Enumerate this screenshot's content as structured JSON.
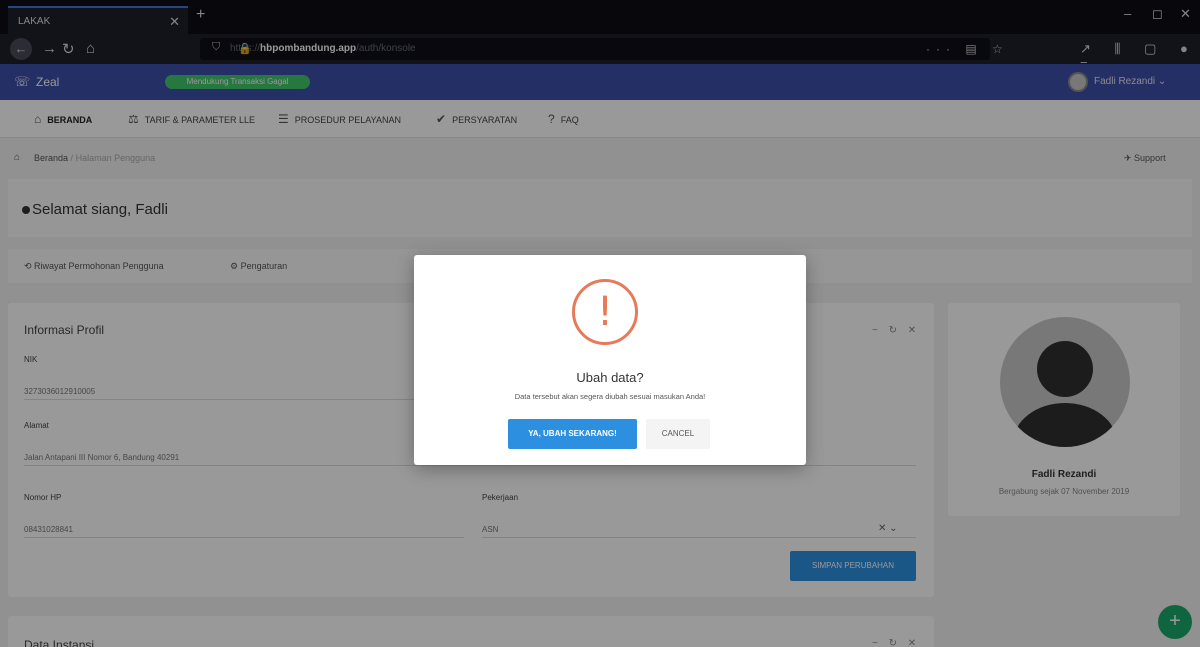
{
  "browser": {
    "tab_title": "LAKAK",
    "tab_close": "✕",
    "new_tab": "+",
    "url_prefix": "https://",
    "url_host": "hbpombandung.app",
    "url_path": "/auth/konsole",
    "url_more": "···",
    "window_min": "–",
    "window_max": "◻",
    "window_close": "✕"
  },
  "app": {
    "brand": "Zeal",
    "status_badge": "Mendukung Transaksi Gagal",
    "user_name": "Fadli Rezandi"
  },
  "menu": [
    {
      "icon": "⌂",
      "label": "Beranda",
      "name": "beranda"
    },
    {
      "icon": "⚖",
      "label": "Tarif & Parameter LLE",
      "name": "tarif"
    },
    {
      "icon": "☰",
      "label": "Prosedur Pelayanan",
      "name": "prosedur"
    },
    {
      "icon": "✔",
      "label": "Persyaratan",
      "name": "persyaratan"
    },
    {
      "icon": "?",
      "label": "FAQ",
      "name": "faq"
    }
  ],
  "breadcrumb": {
    "home": "Beranda",
    "separator": "/",
    "current": "Halaman Pengguna",
    "support": "Support"
  },
  "greeting": "Selamat siang, Fadli",
  "subtabs": [
    {
      "label": "Riwayat Permohonan Pengguna",
      "name": "riwayat"
    },
    {
      "label": "Pengaturan",
      "name": "pengaturan"
    }
  ],
  "profile_info": {
    "title": "Informasi Profil",
    "nik_label": "NIK",
    "nik_value": "3273036012910005",
    "alamat_label": "Alamat",
    "alamat_value": "Jalan Antapani III Nomor 6, Bandung 40291",
    "hp_label": "Nomor HP",
    "hp_value": "08431028841",
    "pekerjaan_label": "Pekerjaan",
    "pekerjaan_value": "ASN",
    "save_label": "Simpan Perubahan"
  },
  "instansi": {
    "title": "Data Instansi"
  },
  "profile_card": {
    "name": "Fadli Rezandi",
    "since": "Bergabung sejak 07 November 2019"
  },
  "dialog": {
    "icon": "!",
    "title": "Ubah data?",
    "text": "Data tersebut akan segera diubah sesuai masukan Anda!",
    "confirm": "YA, UBAH SEKARANG!",
    "cancel": "CANCEL"
  },
  "colors": {
    "header": "#3d4fa8",
    "primary": "#2c8fe0",
    "warning": "#e87a5a",
    "success": "#41c66b"
  }
}
